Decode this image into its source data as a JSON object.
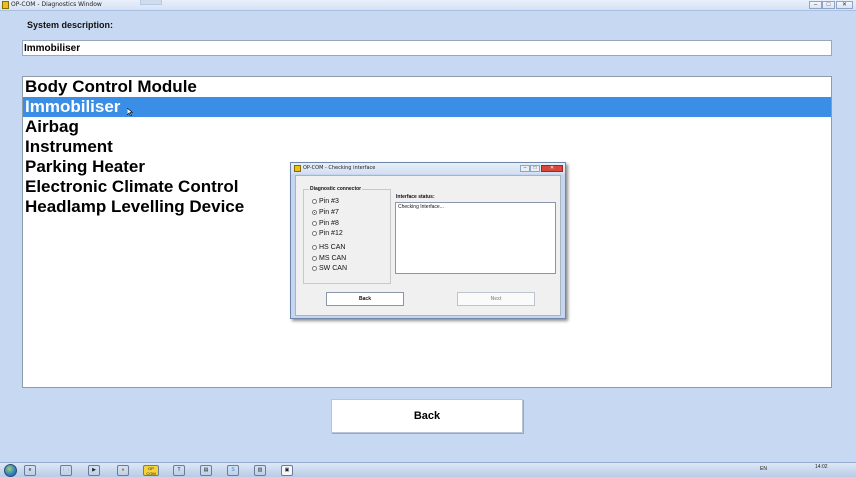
{
  "window": {
    "title": "OP-COM - Diagnostics Window",
    "controls": {
      "minimize": "–",
      "maximize": "□",
      "close": "✕"
    }
  },
  "system_description": {
    "label": "System description:",
    "value": "Immobiliser"
  },
  "modules": [
    {
      "label": "Body Control Module",
      "selected": false
    },
    {
      "label": "Immobiliser",
      "selected": true
    },
    {
      "label": "Airbag",
      "selected": false
    },
    {
      "label": "Instrument",
      "selected": false
    },
    {
      "label": "Parking Heater",
      "selected": false
    },
    {
      "label": "Electronic Climate Control",
      "selected": false
    },
    {
      "label": "Headlamp Levelling Device",
      "selected": false
    }
  ],
  "back_button": "Back",
  "dialog": {
    "title": "OP-COM - Checking interface",
    "controls": {
      "minimize": "–",
      "maximize": "□",
      "close": "✕"
    },
    "group_label": "Diagnostic connector",
    "options": [
      {
        "label": "Pin #3",
        "checked": false
      },
      {
        "label": "Pin #7",
        "checked": true
      },
      {
        "label": "Pin #8",
        "checked": false
      },
      {
        "label": "Pin #12",
        "checked": false
      },
      {
        "label": "HS CAN",
        "checked": false
      },
      {
        "label": "MS CAN",
        "checked": false
      },
      {
        "label": "SW CAN",
        "checked": false
      }
    ],
    "status_label": "Interface status:",
    "status_text": "Checking Interface...",
    "back_label": "Back",
    "next_label": "Next"
  },
  "taskbar": {
    "apps": [
      {
        "icon": "explorer-icon",
        "glyph": "🗀"
      },
      {
        "icon": "media-player-icon",
        "glyph": "▶"
      },
      {
        "icon": "firefox-icon",
        "glyph": "●"
      },
      {
        "icon": "opcom-icon",
        "glyph": "OP COM"
      },
      {
        "icon": "notepad-icon",
        "glyph": "T"
      },
      {
        "icon": "folder-icon",
        "glyph": "▤"
      },
      {
        "icon": "skype-icon",
        "glyph": "S"
      },
      {
        "icon": "files-icon",
        "glyph": "▥"
      },
      {
        "icon": "opcom-window-icon",
        "glyph": "▣"
      }
    ],
    "language": "EN",
    "time": "14:02"
  }
}
